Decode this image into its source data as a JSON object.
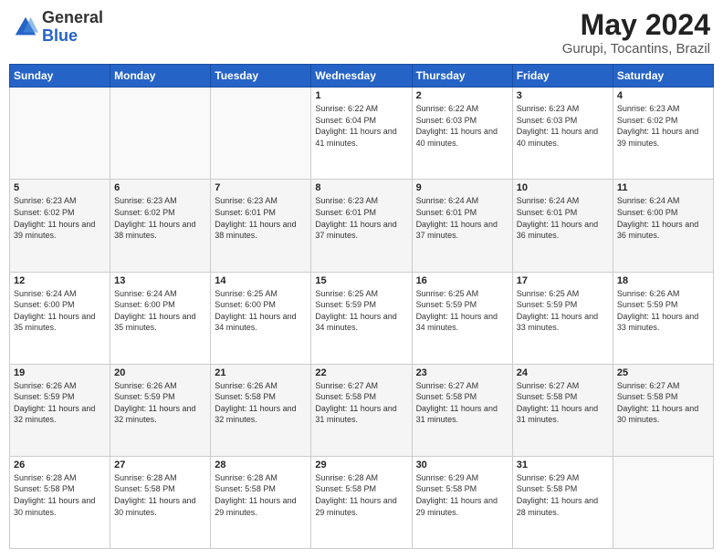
{
  "header": {
    "logo": {
      "general": "General",
      "blue": "Blue"
    },
    "title": "May 2024",
    "location": "Gurupi, Tocantins, Brazil"
  },
  "weekdays": [
    "Sunday",
    "Monday",
    "Tuesday",
    "Wednesday",
    "Thursday",
    "Friday",
    "Saturday"
  ],
  "weeks": [
    [
      {
        "day": "",
        "sunrise": "",
        "sunset": "",
        "daylight": ""
      },
      {
        "day": "",
        "sunrise": "",
        "sunset": "",
        "daylight": ""
      },
      {
        "day": "",
        "sunrise": "",
        "sunset": "",
        "daylight": ""
      },
      {
        "day": "1",
        "sunrise": "Sunrise: 6:22 AM",
        "sunset": "Sunset: 6:04 PM",
        "daylight": "Daylight: 11 hours and 41 minutes."
      },
      {
        "day": "2",
        "sunrise": "Sunrise: 6:22 AM",
        "sunset": "Sunset: 6:03 PM",
        "daylight": "Daylight: 11 hours and 40 minutes."
      },
      {
        "day": "3",
        "sunrise": "Sunrise: 6:23 AM",
        "sunset": "Sunset: 6:03 PM",
        "daylight": "Daylight: 11 hours and 40 minutes."
      },
      {
        "day": "4",
        "sunrise": "Sunrise: 6:23 AM",
        "sunset": "Sunset: 6:02 PM",
        "daylight": "Daylight: 11 hours and 39 minutes."
      }
    ],
    [
      {
        "day": "5",
        "sunrise": "Sunrise: 6:23 AM",
        "sunset": "Sunset: 6:02 PM",
        "daylight": "Daylight: 11 hours and 39 minutes."
      },
      {
        "day": "6",
        "sunrise": "Sunrise: 6:23 AM",
        "sunset": "Sunset: 6:02 PM",
        "daylight": "Daylight: 11 hours and 38 minutes."
      },
      {
        "day": "7",
        "sunrise": "Sunrise: 6:23 AM",
        "sunset": "Sunset: 6:01 PM",
        "daylight": "Daylight: 11 hours and 38 minutes."
      },
      {
        "day": "8",
        "sunrise": "Sunrise: 6:23 AM",
        "sunset": "Sunset: 6:01 PM",
        "daylight": "Daylight: 11 hours and 37 minutes."
      },
      {
        "day": "9",
        "sunrise": "Sunrise: 6:24 AM",
        "sunset": "Sunset: 6:01 PM",
        "daylight": "Daylight: 11 hours and 37 minutes."
      },
      {
        "day": "10",
        "sunrise": "Sunrise: 6:24 AM",
        "sunset": "Sunset: 6:01 PM",
        "daylight": "Daylight: 11 hours and 36 minutes."
      },
      {
        "day": "11",
        "sunrise": "Sunrise: 6:24 AM",
        "sunset": "Sunset: 6:00 PM",
        "daylight": "Daylight: 11 hours and 36 minutes."
      }
    ],
    [
      {
        "day": "12",
        "sunrise": "Sunrise: 6:24 AM",
        "sunset": "Sunset: 6:00 PM",
        "daylight": "Daylight: 11 hours and 35 minutes."
      },
      {
        "day": "13",
        "sunrise": "Sunrise: 6:24 AM",
        "sunset": "Sunset: 6:00 PM",
        "daylight": "Daylight: 11 hours and 35 minutes."
      },
      {
        "day": "14",
        "sunrise": "Sunrise: 6:25 AM",
        "sunset": "Sunset: 6:00 PM",
        "daylight": "Daylight: 11 hours and 34 minutes."
      },
      {
        "day": "15",
        "sunrise": "Sunrise: 6:25 AM",
        "sunset": "Sunset: 5:59 PM",
        "daylight": "Daylight: 11 hours and 34 minutes."
      },
      {
        "day": "16",
        "sunrise": "Sunrise: 6:25 AM",
        "sunset": "Sunset: 5:59 PM",
        "daylight": "Daylight: 11 hours and 34 minutes."
      },
      {
        "day": "17",
        "sunrise": "Sunrise: 6:25 AM",
        "sunset": "Sunset: 5:59 PM",
        "daylight": "Daylight: 11 hours and 33 minutes."
      },
      {
        "day": "18",
        "sunrise": "Sunrise: 6:26 AM",
        "sunset": "Sunset: 5:59 PM",
        "daylight": "Daylight: 11 hours and 33 minutes."
      }
    ],
    [
      {
        "day": "19",
        "sunrise": "Sunrise: 6:26 AM",
        "sunset": "Sunset: 5:59 PM",
        "daylight": "Daylight: 11 hours and 32 minutes."
      },
      {
        "day": "20",
        "sunrise": "Sunrise: 6:26 AM",
        "sunset": "Sunset: 5:59 PM",
        "daylight": "Daylight: 11 hours and 32 minutes."
      },
      {
        "day": "21",
        "sunrise": "Sunrise: 6:26 AM",
        "sunset": "Sunset: 5:58 PM",
        "daylight": "Daylight: 11 hours and 32 minutes."
      },
      {
        "day": "22",
        "sunrise": "Sunrise: 6:27 AM",
        "sunset": "Sunset: 5:58 PM",
        "daylight": "Daylight: 11 hours and 31 minutes."
      },
      {
        "day": "23",
        "sunrise": "Sunrise: 6:27 AM",
        "sunset": "Sunset: 5:58 PM",
        "daylight": "Daylight: 11 hours and 31 minutes."
      },
      {
        "day": "24",
        "sunrise": "Sunrise: 6:27 AM",
        "sunset": "Sunset: 5:58 PM",
        "daylight": "Daylight: 11 hours and 31 minutes."
      },
      {
        "day": "25",
        "sunrise": "Sunrise: 6:27 AM",
        "sunset": "Sunset: 5:58 PM",
        "daylight": "Daylight: 11 hours and 30 minutes."
      }
    ],
    [
      {
        "day": "26",
        "sunrise": "Sunrise: 6:28 AM",
        "sunset": "Sunset: 5:58 PM",
        "daylight": "Daylight: 11 hours and 30 minutes."
      },
      {
        "day": "27",
        "sunrise": "Sunrise: 6:28 AM",
        "sunset": "Sunset: 5:58 PM",
        "daylight": "Daylight: 11 hours and 30 minutes."
      },
      {
        "day": "28",
        "sunrise": "Sunrise: 6:28 AM",
        "sunset": "Sunset: 5:58 PM",
        "daylight": "Daylight: 11 hours and 29 minutes."
      },
      {
        "day": "29",
        "sunrise": "Sunrise: 6:28 AM",
        "sunset": "Sunset: 5:58 PM",
        "daylight": "Daylight: 11 hours and 29 minutes."
      },
      {
        "day": "30",
        "sunrise": "Sunrise: 6:29 AM",
        "sunset": "Sunset: 5:58 PM",
        "daylight": "Daylight: 11 hours and 29 minutes."
      },
      {
        "day": "31",
        "sunrise": "Sunrise: 6:29 AM",
        "sunset": "Sunset: 5:58 PM",
        "daylight": "Daylight: 11 hours and 28 minutes."
      },
      {
        "day": "",
        "sunrise": "",
        "sunset": "",
        "daylight": ""
      }
    ]
  ]
}
